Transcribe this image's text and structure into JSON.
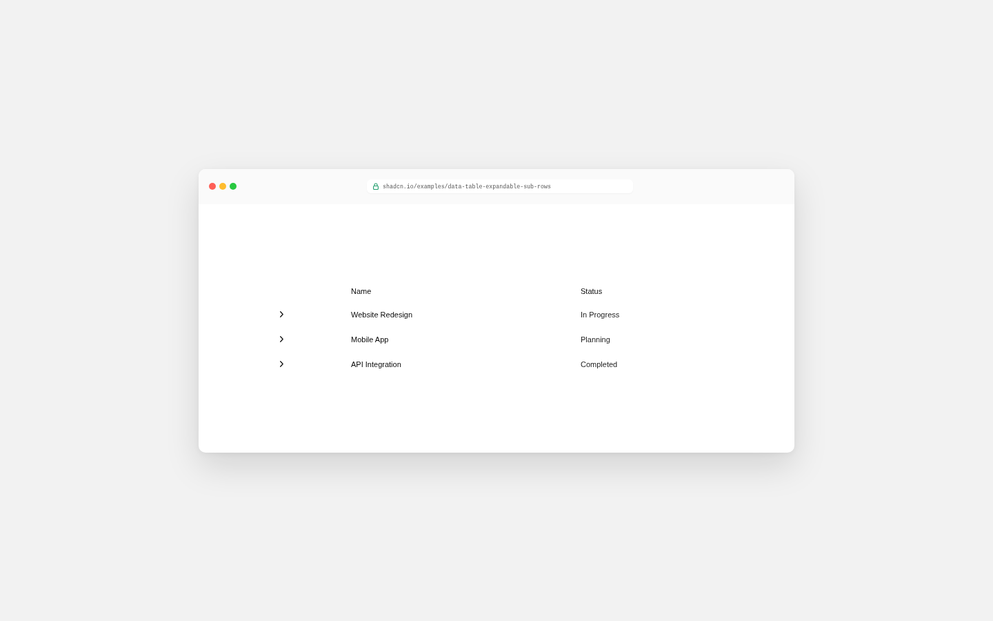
{
  "browser": {
    "url": "shadcn.io/examples/data-table-expandable-sub-rows"
  },
  "table": {
    "columns": [
      "Name",
      "Status"
    ],
    "rows": [
      {
        "name": "Website Redesign",
        "status": "In Progress",
        "expanded": false
      },
      {
        "name": "Mobile App",
        "status": "Planning",
        "expanded": false
      },
      {
        "name": "API Integration",
        "status": "Completed",
        "expanded": false
      }
    ]
  }
}
